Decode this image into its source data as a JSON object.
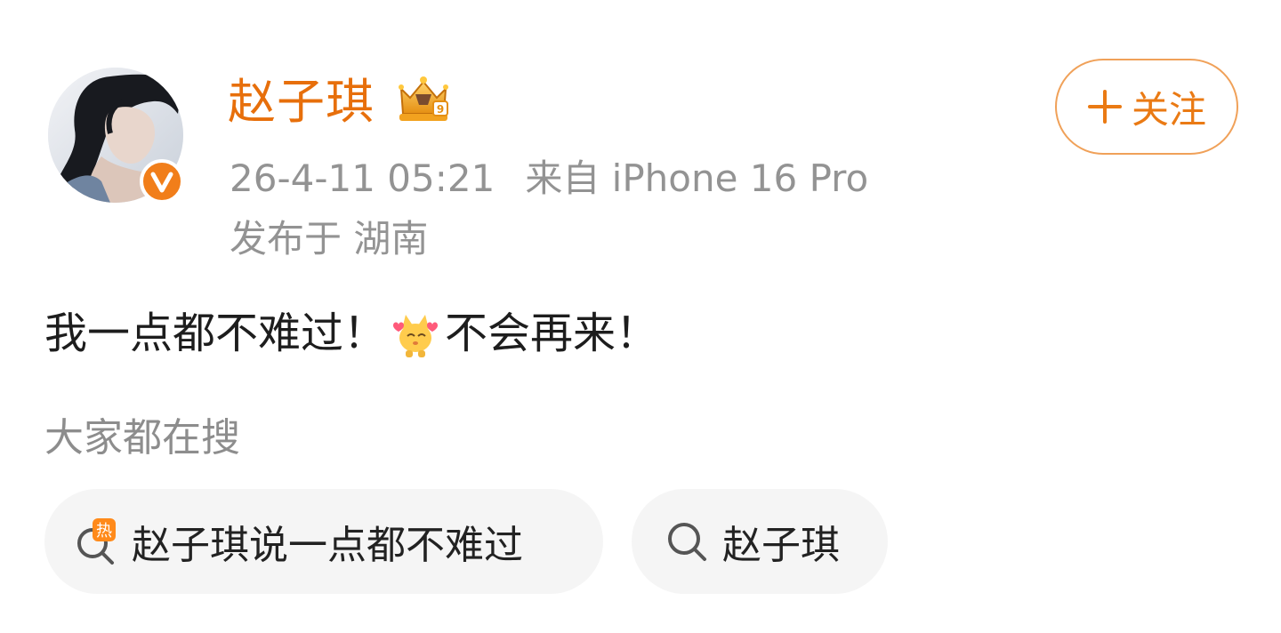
{
  "post": {
    "author": {
      "name": "赵子琪",
      "avatar_icon": "avatar-photo",
      "verified_icon": "verified-v-icon",
      "level_icon": "crown-level-icon"
    },
    "timestamp": "26-4-11 05:21",
    "source": "来自 iPhone 16 Pro",
    "location": "发布于 湖南",
    "follow_label": "关注",
    "content": {
      "text_before_emoji": "我一点都不难过！",
      "emoji_icon": "cat-heart-emoji",
      "text_after_emoji": "不会再来！"
    }
  },
  "trending": {
    "title": "大家都在搜",
    "items": [
      {
        "label": "赵子琪说一点都不难过",
        "icon": "hot-search-icon",
        "badge": "热"
      },
      {
        "label": "赵子琪",
        "icon": "search-icon"
      }
    ]
  },
  "colors": {
    "accent": "#e76f0b",
    "meta_text": "#939393",
    "chip_bg": "#f5f5f5"
  }
}
